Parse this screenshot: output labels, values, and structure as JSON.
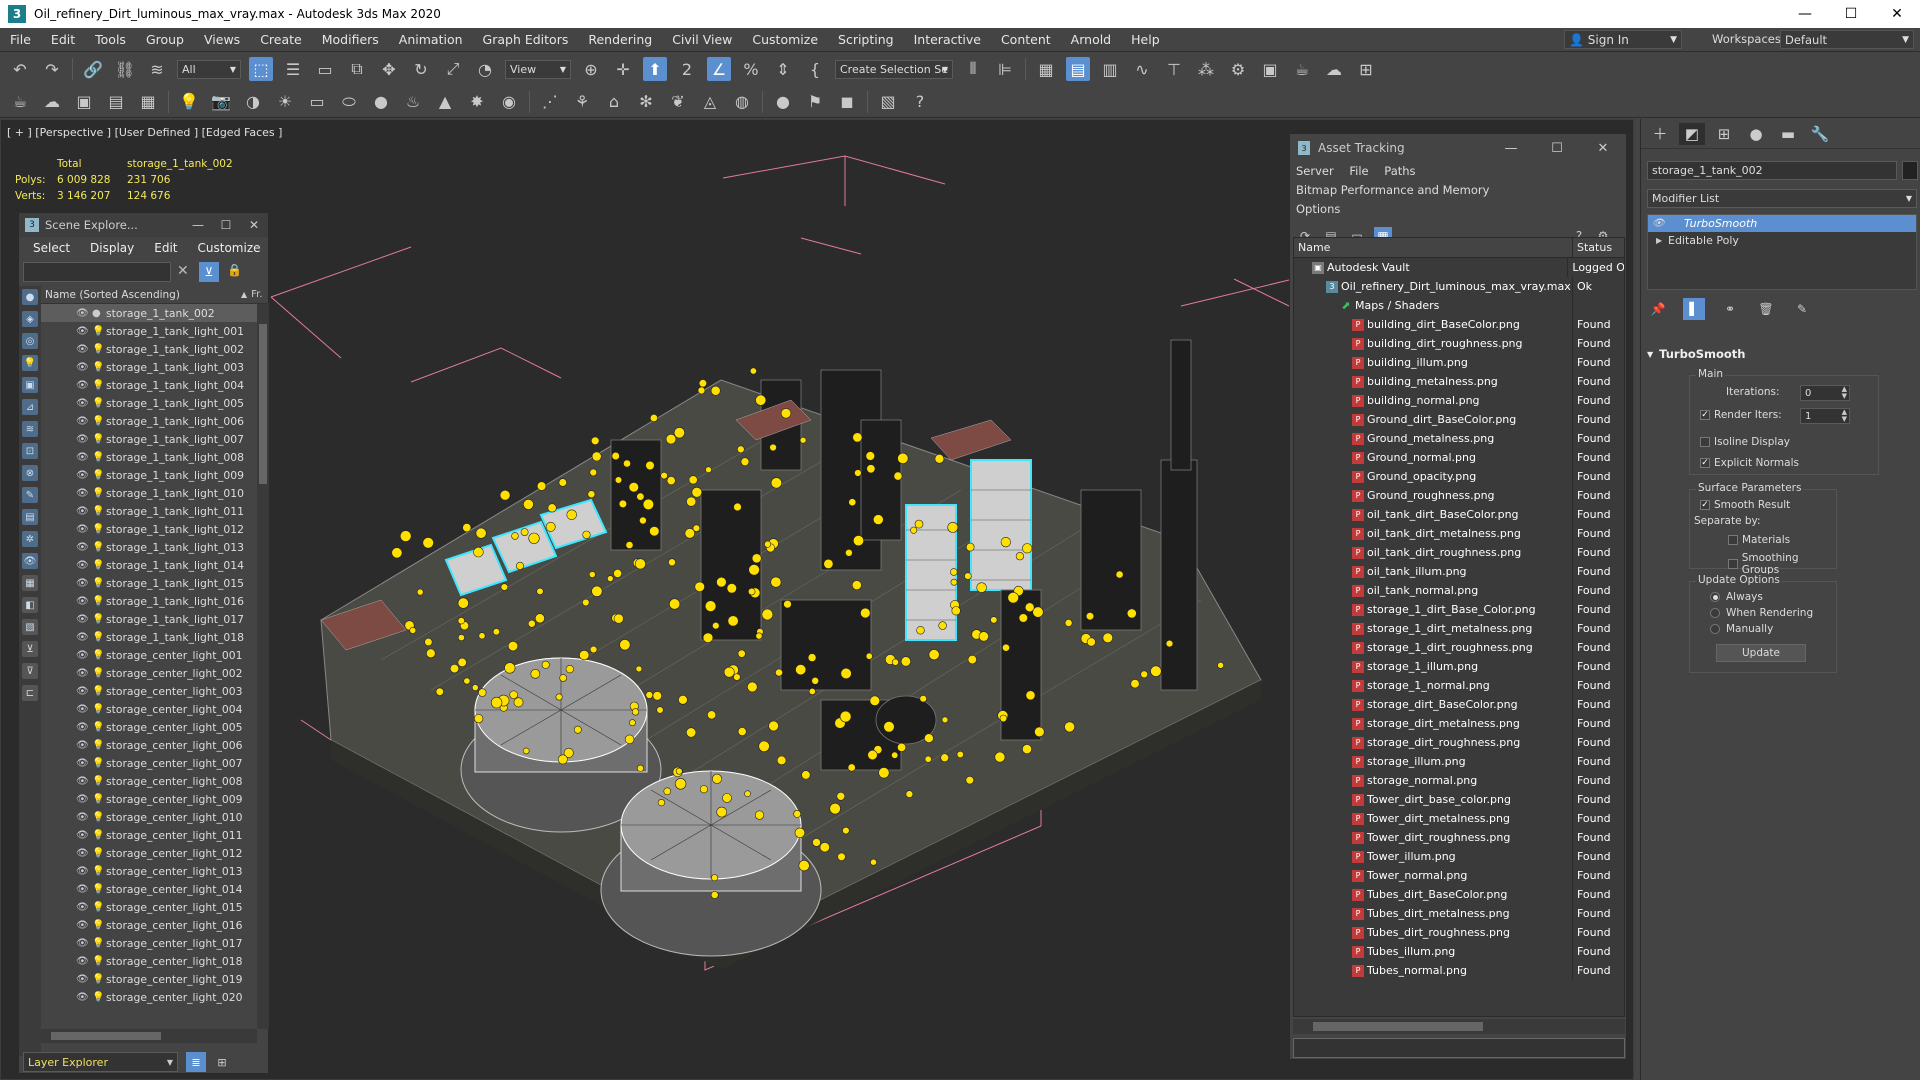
{
  "window": {
    "title": "Oil_refinery_Dirt_luminous_max_vray.max - Autodesk 3ds Max 2020",
    "app_icon": "3"
  },
  "menu": [
    "File",
    "Edit",
    "Tools",
    "Group",
    "Views",
    "Create",
    "Modifiers",
    "Animation",
    "Graph Editors",
    "Rendering",
    "Civil View",
    "Customize",
    "Scripting",
    "Interactive",
    "Content",
    "Arnold",
    "Help"
  ],
  "account": {
    "sign_in": "Sign In",
    "workspaces_label": "Workspaces:",
    "workspace": "Default"
  },
  "toolbar": {
    "filter_all": "All",
    "view": "View",
    "create_selection": "Create Selection Se"
  },
  "viewport": {
    "label": "[ + ] [Perspective ] [User Defined ] [Edged Faces ]",
    "stats": {
      "total_label": "Total",
      "object": "storage_1_tank_002",
      "polys_label": "Polys:",
      "polys_total": "6 009 828",
      "polys_sel": "231 706",
      "verts_label": "Verts:",
      "verts_total": "3 146 207",
      "verts_sel": "124 676"
    }
  },
  "scene_explorer": {
    "title": "Scene Explore...",
    "menu": [
      "Select",
      "Display",
      "Edit",
      "Customize"
    ],
    "column_name": "Name (Sorted Ascending)",
    "column_fr": "Fr.",
    "items": [
      "storage_1_tank_002",
      "storage_1_tank_light_001",
      "storage_1_tank_light_002",
      "storage_1_tank_light_003",
      "storage_1_tank_light_004",
      "storage_1_tank_light_005",
      "storage_1_tank_light_006",
      "storage_1_tank_light_007",
      "storage_1_tank_light_008",
      "storage_1_tank_light_009",
      "storage_1_tank_light_010",
      "storage_1_tank_light_011",
      "storage_1_tank_light_012",
      "storage_1_tank_light_013",
      "storage_1_tank_light_014",
      "storage_1_tank_light_015",
      "storage_1_tank_light_016",
      "storage_1_tank_light_017",
      "storage_1_tank_light_018",
      "storage_center_light_001",
      "storage_center_light_002",
      "storage_center_light_003",
      "storage_center_light_004",
      "storage_center_light_005",
      "storage_center_light_006",
      "storage_center_light_007",
      "storage_center_light_008",
      "storage_center_light_009",
      "storage_center_light_010",
      "storage_center_light_011",
      "storage_center_light_012",
      "storage_center_light_013",
      "storage_center_light_014",
      "storage_center_light_015",
      "storage_center_light_016",
      "storage_center_light_017",
      "storage_center_light_018",
      "storage_center_light_019",
      "storage_center_light_020"
    ],
    "footer": "Layer Explorer"
  },
  "asset_tracking": {
    "title": "Asset Tracking",
    "menu": [
      "Server",
      "File",
      "Paths",
      "Bitmap Performance and Memory",
      "Options"
    ],
    "col_name": "Name",
    "col_status": "Status",
    "rows": [
      {
        "name": "Autodesk Vault",
        "status": "Logged O",
        "level": 1,
        "icon": "vault"
      },
      {
        "name": "Oil_refinery_Dirt_luminous_max_vray.max",
        "status": "Ok",
        "level": 2,
        "icon": "max"
      },
      {
        "name": "Maps / Shaders",
        "status": "",
        "level": 3,
        "icon": "maps"
      },
      {
        "name": "building_dirt_BaseColor.png",
        "status": "Found",
        "level": 4,
        "icon": "png"
      },
      {
        "name": "building_dirt_roughness.png",
        "status": "Found",
        "level": 4,
        "icon": "png"
      },
      {
        "name": "building_illum.png",
        "status": "Found",
        "level": 4,
        "icon": "png"
      },
      {
        "name": "building_metalness.png",
        "status": "Found",
        "level": 4,
        "icon": "png"
      },
      {
        "name": "building_normal.png",
        "status": "Found",
        "level": 4,
        "icon": "png"
      },
      {
        "name": "Ground_dirt_BaseColor.png",
        "status": "Found",
        "level": 4,
        "icon": "png"
      },
      {
        "name": "Ground_metalness.png",
        "status": "Found",
        "level": 4,
        "icon": "png"
      },
      {
        "name": "Ground_normal.png",
        "status": "Found",
        "level": 4,
        "icon": "png"
      },
      {
        "name": "Ground_opacity.png",
        "status": "Found",
        "level": 4,
        "icon": "png"
      },
      {
        "name": "Ground_roughness.png",
        "status": "Found",
        "level": 4,
        "icon": "png"
      },
      {
        "name": "oil_tank_dirt_BaseColor.png",
        "status": "Found",
        "level": 4,
        "icon": "png"
      },
      {
        "name": "oil_tank_dirt_metalness.png",
        "status": "Found",
        "level": 4,
        "icon": "png"
      },
      {
        "name": "oil_tank_dirt_roughness.png",
        "status": "Found",
        "level": 4,
        "icon": "png"
      },
      {
        "name": "oil_tank_illum.png",
        "status": "Found",
        "level": 4,
        "icon": "png"
      },
      {
        "name": "oil_tank_normal.png",
        "status": "Found",
        "level": 4,
        "icon": "png"
      },
      {
        "name": "storage_1_dirt_Base_Color.png",
        "status": "Found",
        "level": 4,
        "icon": "png"
      },
      {
        "name": "storage_1_dirt_metalness.png",
        "status": "Found",
        "level": 4,
        "icon": "png"
      },
      {
        "name": "storage_1_dirt_roughness.png",
        "status": "Found",
        "level": 4,
        "icon": "png"
      },
      {
        "name": "storage_1_illum.png",
        "status": "Found",
        "level": 4,
        "icon": "png"
      },
      {
        "name": "storage_1_normal.png",
        "status": "Found",
        "level": 4,
        "icon": "png"
      },
      {
        "name": "storage_dirt_BaseColor.png",
        "status": "Found",
        "level": 4,
        "icon": "png"
      },
      {
        "name": "storage_dirt_metalness.png",
        "status": "Found",
        "level": 4,
        "icon": "png"
      },
      {
        "name": "storage_dirt_roughness.png",
        "status": "Found",
        "level": 4,
        "icon": "png"
      },
      {
        "name": "storage_illum.png",
        "status": "Found",
        "level": 4,
        "icon": "png"
      },
      {
        "name": "storage_normal.png",
        "status": "Found",
        "level": 4,
        "icon": "png"
      },
      {
        "name": "Tower_dirt_base_color.png",
        "status": "Found",
        "level": 4,
        "icon": "png"
      },
      {
        "name": "Tower_dirt_metalness.png",
        "status": "Found",
        "level": 4,
        "icon": "png"
      },
      {
        "name": "Tower_dirt_roughness.png",
        "status": "Found",
        "level": 4,
        "icon": "png"
      },
      {
        "name": "Tower_illum.png",
        "status": "Found",
        "level": 4,
        "icon": "png"
      },
      {
        "name": "Tower_normal.png",
        "status": "Found",
        "level": 4,
        "icon": "png"
      },
      {
        "name": "Tubes_dirt_BaseColor.png",
        "status": "Found",
        "level": 4,
        "icon": "png"
      },
      {
        "name": "Tubes_dirt_metalness.png",
        "status": "Found",
        "level": 4,
        "icon": "png"
      },
      {
        "name": "Tubes_dirt_roughness.png",
        "status": "Found",
        "level": 4,
        "icon": "png"
      },
      {
        "name": "Tubes_illum.png",
        "status": "Found",
        "level": 4,
        "icon": "png"
      },
      {
        "name": "Tubes_normal.png",
        "status": "Found",
        "level": 4,
        "icon": "png"
      }
    ]
  },
  "command_panel": {
    "object_name": "storage_1_tank_002",
    "modifier_list": "Modifier List",
    "stack": [
      "TurboSmooth",
      "Editable Poly"
    ],
    "rollout_title": "TurboSmooth",
    "main_label": "Main",
    "iterations_label": "Iterations:",
    "iterations": "0",
    "render_iters_label": "Render Iters:",
    "render_iters": "1",
    "isoline": "Isoline Display",
    "explicit_normals": "Explicit Normals",
    "surface_params": "Surface Parameters",
    "smooth_result": "Smooth Result",
    "separate_by": "Separate by:",
    "materials": "Materials",
    "smoothing_groups": "Smoothing Groups",
    "update_options": "Update Options",
    "always": "Always",
    "when_rendering": "When Rendering",
    "manually": "Manually",
    "update": "Update"
  },
  "colors": {
    "accent": "#5b8fd0",
    "stats_yellow": "#f3e95a",
    "highlight_cyan": "#3fe6ff",
    "bbox_pink": "#e27aa0"
  }
}
